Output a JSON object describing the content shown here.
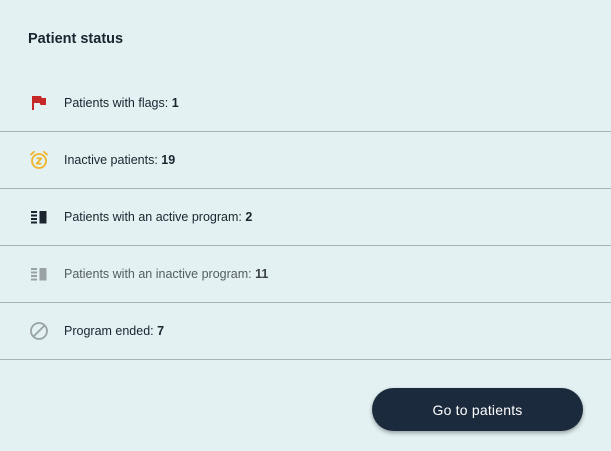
{
  "card": {
    "title": "Patient status"
  },
  "rows": [
    {
      "label": "Patients with flags:",
      "value": "1",
      "icon": "flag-icon"
    },
    {
      "label": "Inactive patients:",
      "value": "19",
      "icon": "snooze-alarm-icon"
    },
    {
      "label": "Patients with an active program:",
      "value": "2",
      "icon": "program-icon"
    },
    {
      "label": "Patients with an inactive program:",
      "value": "11",
      "icon": "program-inactive-icon"
    },
    {
      "label": "Program ended:",
      "value": "7",
      "icon": "ended-icon"
    }
  ],
  "actions": {
    "go_to_patients": "Go to patients"
  },
  "colors": {
    "background": "#e3f1f2",
    "flag": "#c62828",
    "inactive": "#f0b429",
    "primary_button": "#1c2a3d",
    "text": "#1c2430"
  }
}
